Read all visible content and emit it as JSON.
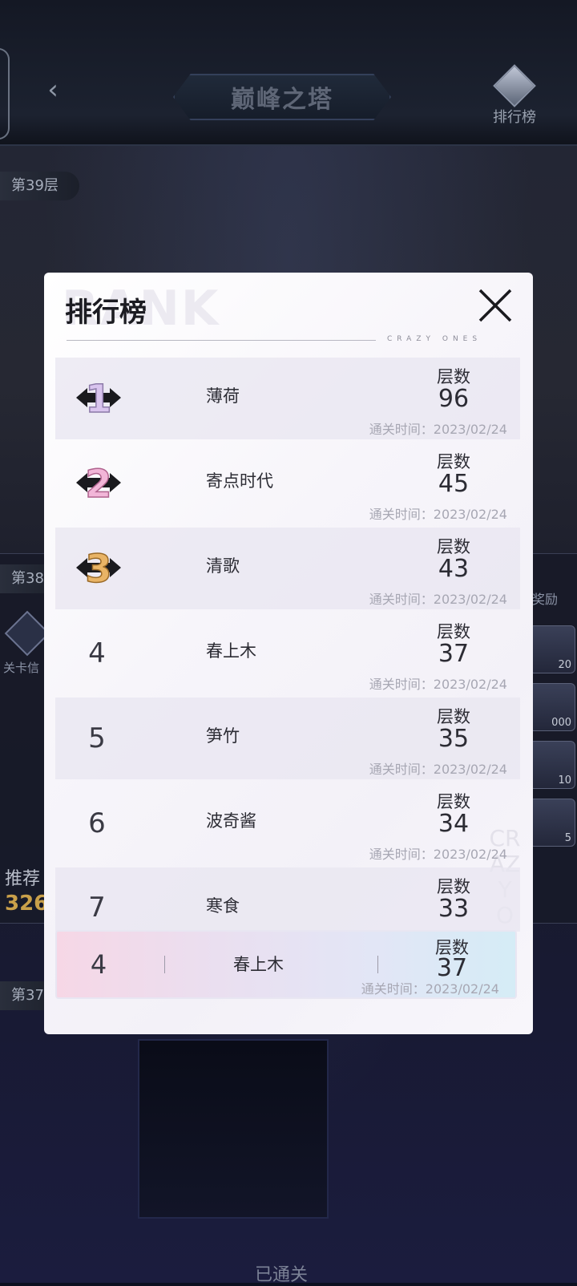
{
  "header": {
    "title": "巅峰之塔",
    "ranking_label": "排行榜"
  },
  "background": {
    "floor_top": "第39层",
    "floor_mid": "第38",
    "floor_low": "第37",
    "stage_info": "关卡信",
    "reward_label": "奖励",
    "recommend_label": "推荐",
    "recommend_value": "326",
    "rewards": [
      "20",
      "000",
      "10",
      "5"
    ],
    "passed_label": "已通关"
  },
  "modal": {
    "title": "排行榜",
    "watermark": "RANK",
    "subtitle": "CRAZY ONES",
    "side_watermark": "CRAZY O",
    "rows": [
      {
        "rank": "1",
        "name": "薄荷",
        "level_label": "层数",
        "level": "96",
        "time": "通关时间：2023/02/24"
      },
      {
        "rank": "2",
        "name": "寄点时代",
        "level_label": "层数",
        "level": "45",
        "time": "通关时间：2023/02/24"
      },
      {
        "rank": "3",
        "name": "清歌",
        "level_label": "层数",
        "level": "43",
        "time": "通关时间：2023/02/24"
      },
      {
        "rank": "4",
        "name": "春上木",
        "level_label": "层数",
        "level": "37",
        "time": "通关时间：2023/02/24"
      },
      {
        "rank": "5",
        "name": "笋竹",
        "level_label": "层数",
        "level": "35",
        "time": "通关时间：2023/02/24"
      },
      {
        "rank": "6",
        "name": "波奇酱",
        "level_label": "层数",
        "level": "34",
        "time": "通关时间：2023/02/24"
      },
      {
        "rank": "7",
        "name": "寒食",
        "level_label": "层数",
        "level": "33",
        "time": ""
      }
    ],
    "self": {
      "rank": "4",
      "name": "春上木",
      "level_label": "层数",
      "level": "37",
      "time": "通关时间：2023/02/24"
    }
  },
  "colors": {
    "medal_gold_1": "#d9c4ee",
    "medal_pink_2": "#f2b6d8",
    "medal_bronze_3": "#e9b466"
  }
}
